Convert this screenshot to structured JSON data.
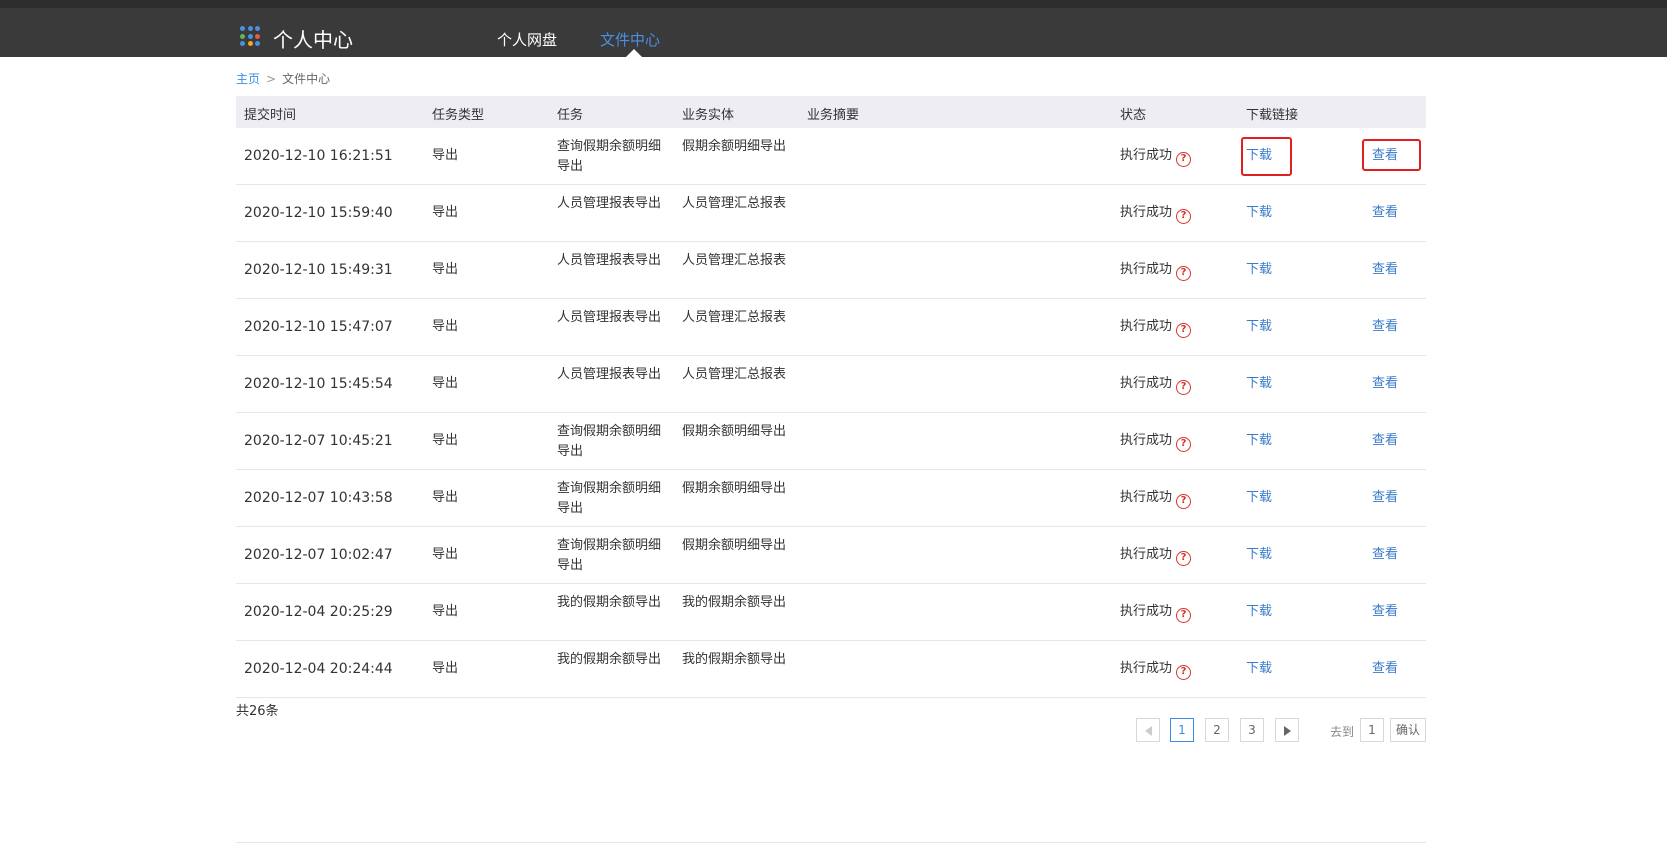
{
  "header": {
    "brand": "个人中心",
    "tabs": [
      {
        "label": "个人网盘"
      },
      {
        "label": "文件中心"
      }
    ],
    "logo_colors": [
      "#4a90e2",
      "#4a90e2",
      "#4a90e2",
      "#5bb85b",
      "#4a90e2",
      "#e05d44",
      "#4a90e2",
      "#f5a623",
      "#4a90e2"
    ]
  },
  "breadcrumb": {
    "home": "主页",
    "separator": ">",
    "current": "文件中心"
  },
  "table": {
    "headers": [
      "提交时间",
      "任务类型",
      "任务",
      "业务实体",
      "业务摘要",
      "状态",
      "下载链接"
    ],
    "rows": [
      {
        "time": "2020-12-10 16:21:51",
        "type": "导出",
        "task": "查询假期余额明细导出",
        "entity": "假期余额明细导出",
        "summary": "",
        "status": "执行成功",
        "download": "下载",
        "view": "查看"
      },
      {
        "time": "2020-12-10 15:59:40",
        "type": "导出",
        "task": "人员管理报表导出",
        "entity": "人员管理汇总报表",
        "summary": "",
        "status": "执行成功",
        "download": "下载",
        "view": "查看"
      },
      {
        "time": "2020-12-10 15:49:31",
        "type": "导出",
        "task": "人员管理报表导出",
        "entity": "人员管理汇总报表",
        "summary": "",
        "status": "执行成功",
        "download": "下载",
        "view": "查看"
      },
      {
        "time": "2020-12-10 15:47:07",
        "type": "导出",
        "task": "人员管理报表导出",
        "entity": "人员管理汇总报表",
        "summary": "",
        "status": "执行成功",
        "download": "下载",
        "view": "查看"
      },
      {
        "time": "2020-12-10 15:45:54",
        "type": "导出",
        "task": "人员管理报表导出",
        "entity": "人员管理汇总报表",
        "summary": "",
        "status": "执行成功",
        "download": "下载",
        "view": "查看"
      },
      {
        "time": "2020-12-07 10:45:21",
        "type": "导出",
        "task": "查询假期余额明细导出",
        "entity": "假期余额明细导出",
        "summary": "",
        "status": "执行成功",
        "download": "下载",
        "view": "查看"
      },
      {
        "time": "2020-12-07 10:43:58",
        "type": "导出",
        "task": "查询假期余额明细导出",
        "entity": "假期余额明细导出",
        "summary": "",
        "status": "执行成功",
        "download": "下载",
        "view": "查看"
      },
      {
        "time": "2020-12-07 10:02:47",
        "type": "导出",
        "task": "查询假期余额明细导出",
        "entity": "假期余额明细导出",
        "summary": "",
        "status": "执行成功",
        "download": "下载",
        "view": "查看"
      },
      {
        "time": "2020-12-04 20:25:29",
        "type": "导出",
        "task": "我的假期余额导出",
        "entity": "我的假期余额导出",
        "summary": "",
        "status": "执行成功",
        "download": "下载",
        "view": "查看"
      },
      {
        "time": "2020-12-04 20:24:44",
        "type": "导出",
        "task": "我的假期余额导出",
        "entity": "我的假期余额导出",
        "summary": "",
        "status": "执行成功",
        "download": "下载",
        "view": "查看"
      }
    ]
  },
  "footer": {
    "total": "共26条",
    "pages": [
      "1",
      "2",
      "3"
    ],
    "current_page": "1",
    "goto_label": "去到",
    "goto_value": "1",
    "confirm": "确认"
  },
  "colors": {
    "header_bg": "#3a3a3a",
    "active_tab": "#4a90e2",
    "link": "#3a7bc8",
    "status_icon": "#d9342b",
    "highlight_box": "#e0201c"
  }
}
